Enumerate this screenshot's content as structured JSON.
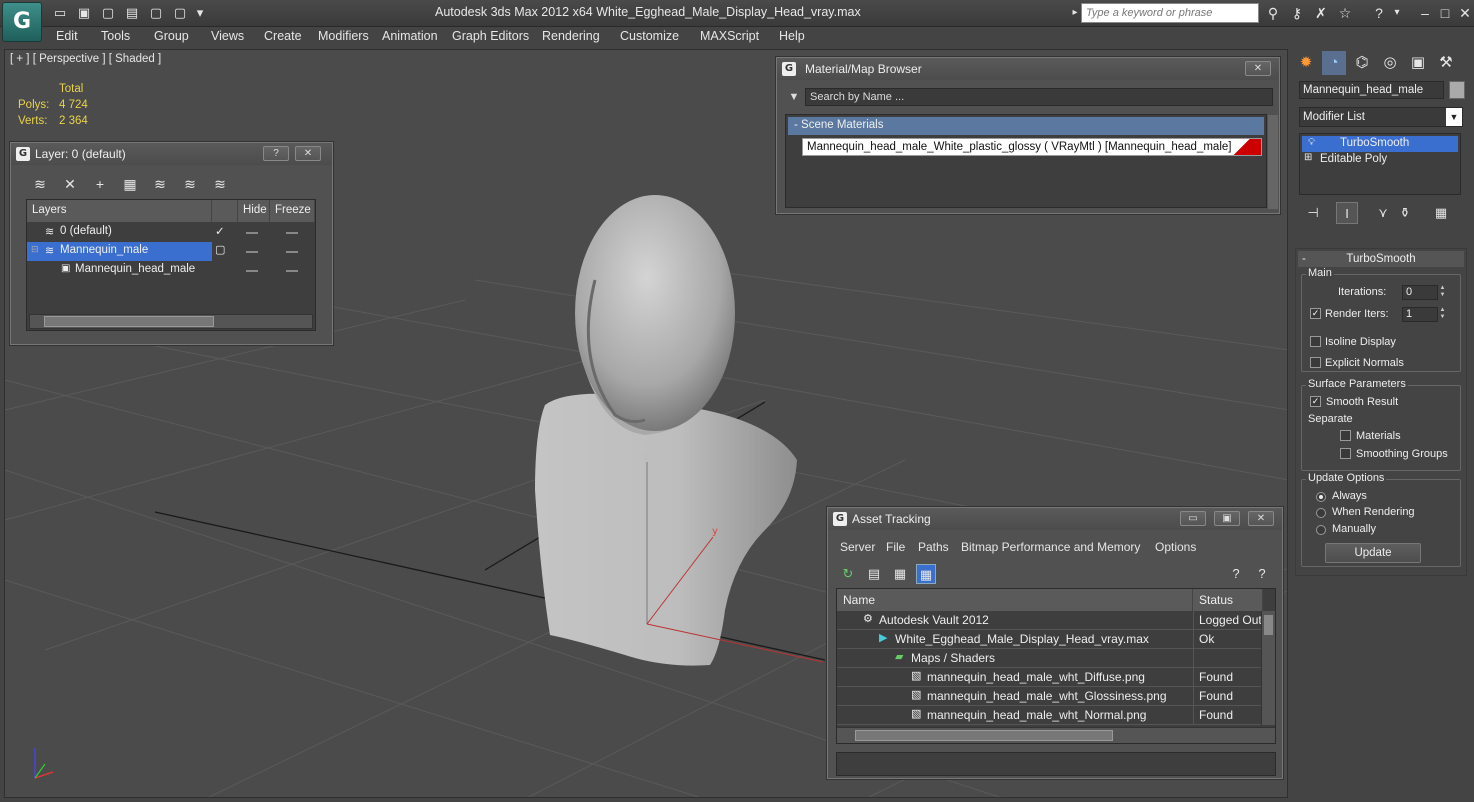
{
  "window": {
    "title": "Autodesk 3ds Max  2012 x64      White_Egghead_Male_Display_Head_vray.max",
    "search_placeholder": "Type a keyword or phrase"
  },
  "menu": [
    "Edit",
    "Tools",
    "Group",
    "Views",
    "Create",
    "Modifiers",
    "Animation",
    "Graph Editors",
    "Rendering",
    "Customize",
    "MAXScript",
    "Help"
  ],
  "viewport": {
    "label": "[ + ] [ Perspective ] [ Shaded ]",
    "stats": {
      "total_label": "Total",
      "polys_label": "Polys:",
      "polys_value": "4 724",
      "verts_label": "Verts:",
      "verts_value": "2 364"
    },
    "axis_labels": {
      "z": "z",
      "y": "y"
    }
  },
  "layer_panel": {
    "title": "Layer: 0 (default)",
    "help_btn": "?",
    "close_btn": "✕",
    "columns": [
      "Layers",
      "Hide",
      "Freeze"
    ],
    "rows": [
      "0 (default)",
      "Mannequin_male",
      "Mannequin_head_male"
    ]
  },
  "material_browser": {
    "title": "Material/Map Browser",
    "close_btn": "✕",
    "search_placeholder": "Search by Name ...",
    "scene_header": "- Scene Materials",
    "item": "Mannequin_head_male_White_plastic_glossy  ( VRayMtl ) [Mannequin_head_male]"
  },
  "asset_tracking": {
    "title": "Asset Tracking",
    "menu": [
      "Server",
      "File",
      "Paths",
      "Bitmap Performance and Memory",
      "Options"
    ],
    "columns": [
      "Name",
      "Status"
    ],
    "rows": [
      {
        "name": "Autodesk Vault 2012",
        "status": "Logged Out"
      },
      {
        "name": "White_Egghead_Male_Display_Head_vray.max",
        "status": "Ok"
      },
      {
        "name": "Maps / Shaders",
        "status": ""
      },
      {
        "name": "mannequin_head_male_wht_Diffuse.png",
        "status": "Found"
      },
      {
        "name": "mannequin_head_male_wht_Glossiness.png",
        "status": "Found"
      },
      {
        "name": "mannequin_head_male_wht_Normal.png",
        "status": "Found"
      }
    ]
  },
  "command_panel": {
    "object_name": "Mannequin_head_male",
    "modifier_list": "Modifier List",
    "stack": [
      "TurboSmooth",
      "Editable Poly"
    ],
    "rollout_title": "TurboSmooth",
    "main_group": "Main",
    "iterations_label": "Iterations:",
    "iterations_value": "0",
    "render_iters_label": "Render Iters:",
    "render_iters_value": "1",
    "isoline": "Isoline Display",
    "explicit_normals": "Explicit Normals",
    "surface_group": "Surface Parameters",
    "smooth_result": "Smooth Result",
    "separate_label": "Separate",
    "materials": "Materials",
    "smoothing_groups": "Smoothing Groups",
    "update_group": "Update Options",
    "always": "Always",
    "when_rendering": "When Rendering",
    "manually": "Manually",
    "update_btn": "Update"
  }
}
